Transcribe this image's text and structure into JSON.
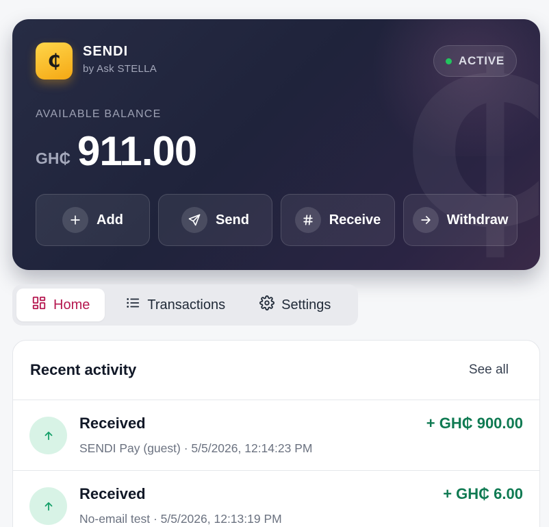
{
  "card": {
    "logo_symbol": "₵",
    "brand_name": "SENDI",
    "brand_sub": "by Ask STELLA",
    "status": "ACTIVE",
    "status_color": "#22c55e",
    "balance_label": "AVAILABLE BALANCE",
    "currency": "GH₵",
    "balance": "911.00",
    "watermark_symbol": "₵",
    "actions": [
      {
        "label": "Add",
        "icon": "plus-icon"
      },
      {
        "label": "Send",
        "icon": "send-icon"
      },
      {
        "label": "Receive",
        "icon": "hash-icon"
      },
      {
        "label": "Withdraw",
        "icon": "arrow-right-icon"
      }
    ]
  },
  "tabs": [
    {
      "label": "Home",
      "icon": "grid-icon",
      "active": true
    },
    {
      "label": "Transactions",
      "icon": "list-icon",
      "active": false
    },
    {
      "label": "Settings",
      "icon": "gear-icon",
      "active": false
    }
  ],
  "activity": {
    "title": "Recent activity",
    "see_all": "See all",
    "items": [
      {
        "title": "Received",
        "meta": "SENDI Pay (guest) · 5/5/2026, 12:14:23 PM",
        "amount": "+ GH₵ 900.00",
        "icon": "arrow-up-icon"
      },
      {
        "title": "Received",
        "meta": "No-email test · 5/5/2026, 12:13:19 PM",
        "amount": "+ GH₵ 6.00",
        "icon": "arrow-up-icon"
      }
    ]
  },
  "colors": {
    "accent": "#b5174f",
    "positive": "#0f7a52",
    "card_bg": "#1f233b",
    "logo": "#ffc62e"
  }
}
